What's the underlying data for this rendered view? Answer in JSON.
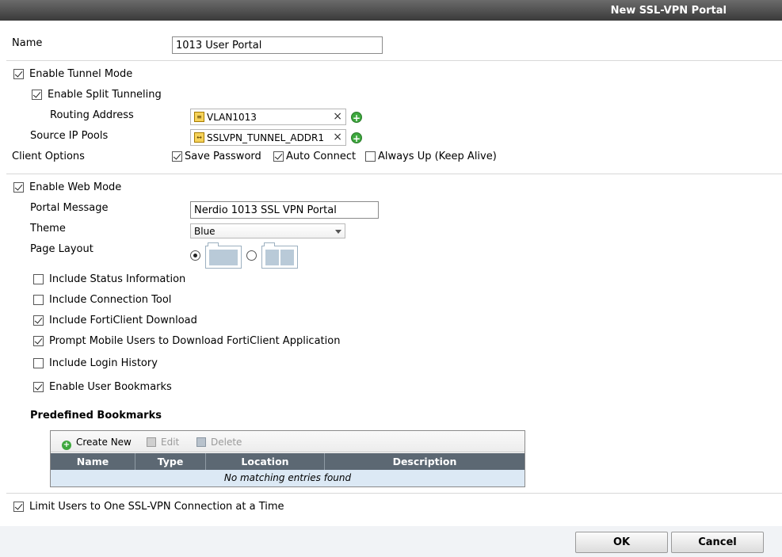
{
  "title": "New SSL-VPN Portal",
  "name": {
    "label": "Name",
    "value": "1013 User Portal"
  },
  "tunnel": {
    "enable_label": "Enable Tunnel Mode",
    "split_label": "Enable Split Tunneling",
    "routing_label": "Routing Address",
    "routing_value": "VLAN1013",
    "source_label": "Source IP Pools",
    "source_value": "SSLVPN_TUNNEL_ADDR1",
    "client_label": "Client Options",
    "save_password": "Save Password",
    "auto_connect": "Auto Connect",
    "always_up": "Always Up (Keep Alive)"
  },
  "web": {
    "enable_label": "Enable Web Mode",
    "portal_message_label": "Portal Message",
    "portal_message_value": "Nerdio 1013 SSL VPN Portal",
    "theme_label": "Theme",
    "theme_value": "Blue",
    "page_layout_label": "Page Layout",
    "options": [
      {
        "label": "Include Status Information",
        "checked": false
      },
      {
        "label": "Include Connection Tool",
        "checked": false
      },
      {
        "label": "Include FortiClient Download",
        "checked": true
      },
      {
        "label": "Prompt Mobile Users to Download FortiClient Application",
        "checked": true
      },
      {
        "label": "Include Login History",
        "checked": false
      },
      {
        "label": "Enable User Bookmarks",
        "checked": true
      }
    ]
  },
  "bookmarks": {
    "heading": "Predefined Bookmarks",
    "create_new": "Create New",
    "edit": "Edit",
    "delete": "Delete",
    "columns": [
      "Name",
      "Type",
      "Location",
      "Description"
    ],
    "empty": "No matching entries found"
  },
  "limit_label": "Limit Users to One SSL-VPN Connection at a Time",
  "buttons": {
    "ok": "OK",
    "cancel": "Cancel"
  }
}
